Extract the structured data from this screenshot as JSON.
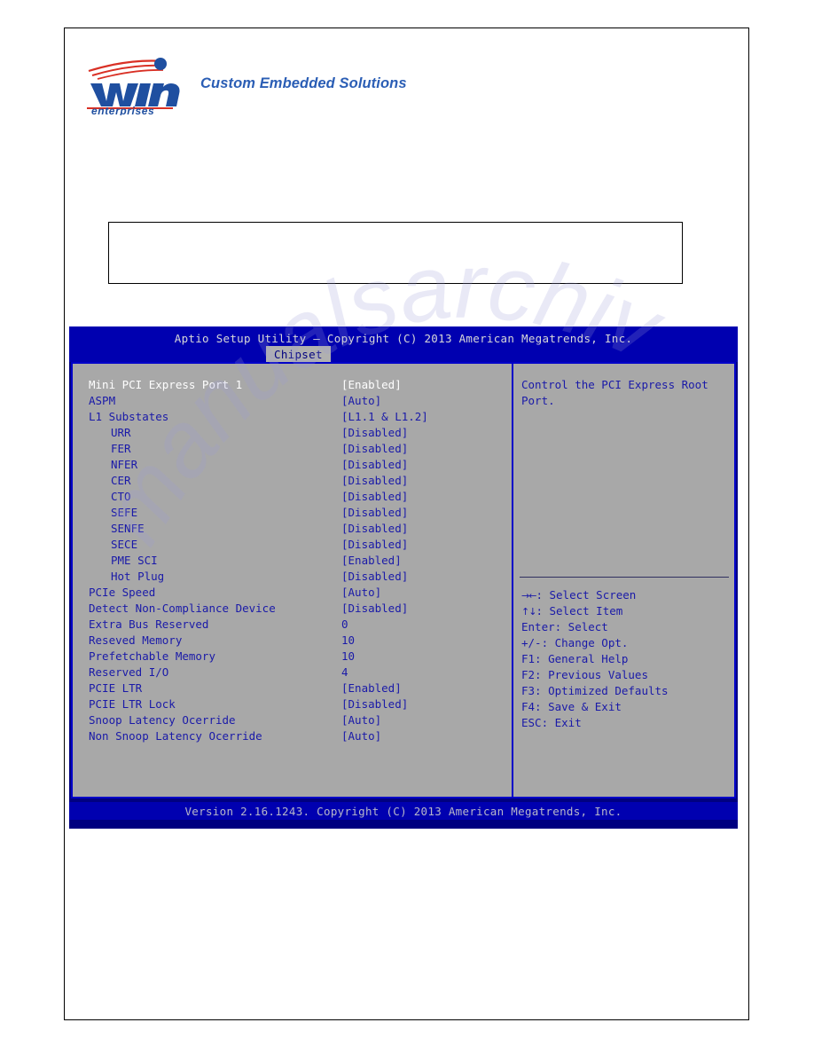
{
  "document": {
    "logo": {
      "brand_name": "win",
      "brand_sub": "enterprises",
      "tagline": "Custom Embedded Solutions"
    },
    "watermark_text": "manualsarchive.com"
  },
  "bios": {
    "title": "Aptio Setup Utility – Copyright (C) 2013 American Megatrends, Inc.",
    "tab": "Chipset",
    "footer": "Version 2.16.1243. Copyright (C) 2013 American Megatrends, Inc.",
    "help": "Control the PCI Express Root Port.",
    "settings": [
      {
        "label": "Mini PCI Express Port 1",
        "value": "[Enabled]",
        "indent": false,
        "selected": true
      },
      {
        "label": "ASPM",
        "value": "[Auto]",
        "indent": false,
        "selected": false
      },
      {
        "label": "L1 Substates",
        "value": "[L1.1 & L1.2]",
        "indent": false,
        "selected": false
      },
      {
        "label": "URR",
        "value": "[Disabled]",
        "indent": true,
        "selected": false
      },
      {
        "label": "FER",
        "value": "[Disabled]",
        "indent": true,
        "selected": false
      },
      {
        "label": "NFER",
        "value": "[Disabled]",
        "indent": true,
        "selected": false
      },
      {
        "label": "CER",
        "value": "[Disabled]",
        "indent": true,
        "selected": false
      },
      {
        "label": "CTO",
        "value": "[Disabled]",
        "indent": true,
        "selected": false
      },
      {
        "label": "SEFE",
        "value": "[Disabled]",
        "indent": true,
        "selected": false
      },
      {
        "label": "SENFE",
        "value": "[Disabled]",
        "indent": true,
        "selected": false
      },
      {
        "label": "SECE",
        "value": "[Disabled]",
        "indent": true,
        "selected": false
      },
      {
        "label": "PME SCI",
        "value": "[Enabled]",
        "indent": true,
        "selected": false
      },
      {
        "label": "Hot Plug",
        "value": "[Disabled]",
        "indent": true,
        "selected": false
      },
      {
        "label": "PCIe Speed",
        "value": "[Auto]",
        "indent": false,
        "selected": false
      },
      {
        "label": "Detect Non-Compliance Device",
        "value": "[Disabled]",
        "indent": false,
        "selected": false
      },
      {
        "label": "Extra Bus Reserved",
        "value": "0",
        "indent": false,
        "selected": false
      },
      {
        "label": "Reseved Memory",
        "value": "10",
        "indent": false,
        "selected": false
      },
      {
        "label": "Prefetchable Memory",
        "value": "10",
        "indent": false,
        "selected": false
      },
      {
        "label": "Reserved I/O",
        "value": "4",
        "indent": false,
        "selected": false
      },
      {
        "label": "PCIE LTR",
        "value": "[Enabled]",
        "indent": false,
        "selected": false
      },
      {
        "label": "PCIE LTR Lock",
        "value": "[Disabled]",
        "indent": false,
        "selected": false
      },
      {
        "label": "Snoop Latency Ocerride",
        "value": "[Auto]",
        "indent": false,
        "selected": false
      },
      {
        "label": "Non Snoop Latency Ocerride",
        "value": "[Auto]",
        "indent": false,
        "selected": false
      }
    ],
    "keys": [
      {
        "glyph": "→←",
        "text": ": Select Screen"
      },
      {
        "glyph": "↑↓",
        "text": ": Select Item"
      },
      {
        "glyph": "",
        "text": "Enter: Select"
      },
      {
        "glyph": "",
        "text": "+/-: Change Opt."
      },
      {
        "glyph": "",
        "text": "F1: General Help"
      },
      {
        "glyph": "",
        "text": "F2: Previous Values"
      },
      {
        "glyph": "",
        "text": "F3: Optimized Defaults"
      },
      {
        "glyph": "",
        "text": "F4: Save & Exit"
      },
      {
        "glyph": "",
        "text": "ESC: Exit"
      }
    ]
  },
  "colors": {
    "bios_blue": "#0000b0",
    "bios_panel": "#a8a8a8",
    "bios_text": "#1a1aa8",
    "selected_text": "#ffffff",
    "brand_blue": "#2b5eb5",
    "brand_red": "#d93025"
  }
}
